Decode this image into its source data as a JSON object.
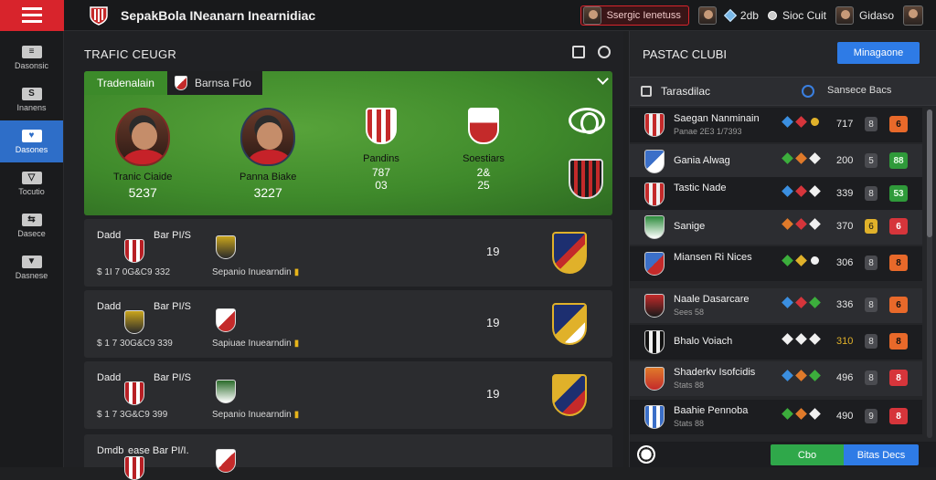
{
  "app": {
    "title": "SepakBola INeanarn Inearnidiac"
  },
  "topbar": {
    "news_label": "Ssergic Ienetuss",
    "gems_value": "2db",
    "club_label": "Sioc Cuit",
    "user_label": "Gidaso"
  },
  "sidebar": {
    "items": [
      {
        "label": "Dasonsic",
        "icon": "dashboard-icon"
      },
      {
        "label": "Inanens",
        "icon": "squad-icon"
      },
      {
        "label": "Dasones",
        "icon": "matches-icon"
      },
      {
        "label": "Tocutio",
        "icon": "tactics-icon"
      },
      {
        "label": "Dasece",
        "icon": "transfers-icon"
      },
      {
        "label": "Dasnese",
        "icon": "settings-icon"
      }
    ]
  },
  "main": {
    "section_title": "TRAFIC CEUGR",
    "featured": {
      "tab_active": "Tradenalain",
      "tab_inactive": "Barnsa Fdo",
      "players": [
        {
          "name": "Tranic Ciaide",
          "stat": "5237"
        },
        {
          "name": "Panna Biake",
          "stat": "3227"
        }
      ],
      "clubs": [
        {
          "name": "Pandins",
          "stat1": "787",
          "stat2": "03"
        },
        {
          "name": "Soestiars",
          "stat1": "2&",
          "stat2": "25"
        }
      ]
    },
    "matches": [
      {
        "label": "Dadd",
        "comp": "Bar PI/S",
        "meta": "1I 7 0G&C9  332",
        "venue": "Sepanio Inuearndin",
        "score": "19"
      },
      {
        "label": "Dadd",
        "comp": "Bar PI/S",
        "meta": "1 7 30G&C9  339",
        "venue": "Sapiuae Inuearndin",
        "score": "19"
      },
      {
        "label": "Dadd",
        "comp": "Bar PI/S",
        "meta": "1 7 3G&C9  399",
        "venue": "Sepanio Inuearndin",
        "score": "19"
      },
      {
        "label": "Dmdb",
        "comp": "ease Bar PI/I.",
        "meta": "",
        "venue": "",
        "score": ""
      }
    ]
  },
  "right_panel": {
    "title": "PASTAC CLUBI",
    "button_label": "Minagaone",
    "filter_label": "Tarasdilac",
    "filter_text": "Sansece Bacs",
    "clubs": [
      {
        "name": "Saegan Nanminain",
        "sub": "Panae 2E3 1/7393",
        "value": "717",
        "toggle": "8",
        "badge": "6"
      },
      {
        "name": "Gania Alwag",
        "sub": "",
        "value": "200",
        "toggle": "5",
        "badge": "88"
      },
      {
        "name": "Tastic Nade",
        "sub": "",
        "value": "339",
        "toggle": "8",
        "badge": "53"
      },
      {
        "name": "Sanige",
        "sub": "",
        "value": "370",
        "toggle": "6",
        "badge": "6"
      },
      {
        "name": "Miansen Ri Nices",
        "sub": "",
        "value": "306",
        "toggle": "8",
        "badge": "8"
      },
      {
        "name": "Naale Dasarcare",
        "sub": "Sees 58",
        "value": "336",
        "toggle": "8",
        "badge": "6"
      },
      {
        "name": "Bhalo Voiach",
        "sub": "",
        "value": "310",
        "toggle": "8",
        "badge": "8"
      },
      {
        "name": "Shaderkv Isofcidis",
        "sub": "Stats 88",
        "value": "496",
        "toggle": "8",
        "badge": "8"
      },
      {
        "name": "Baahie Pennoba",
        "sub": "Stats 88",
        "value": "490",
        "toggle": "9",
        "badge": "8"
      }
    ],
    "footer_green": "Cbo",
    "footer_blue": "Bitas Decs"
  }
}
